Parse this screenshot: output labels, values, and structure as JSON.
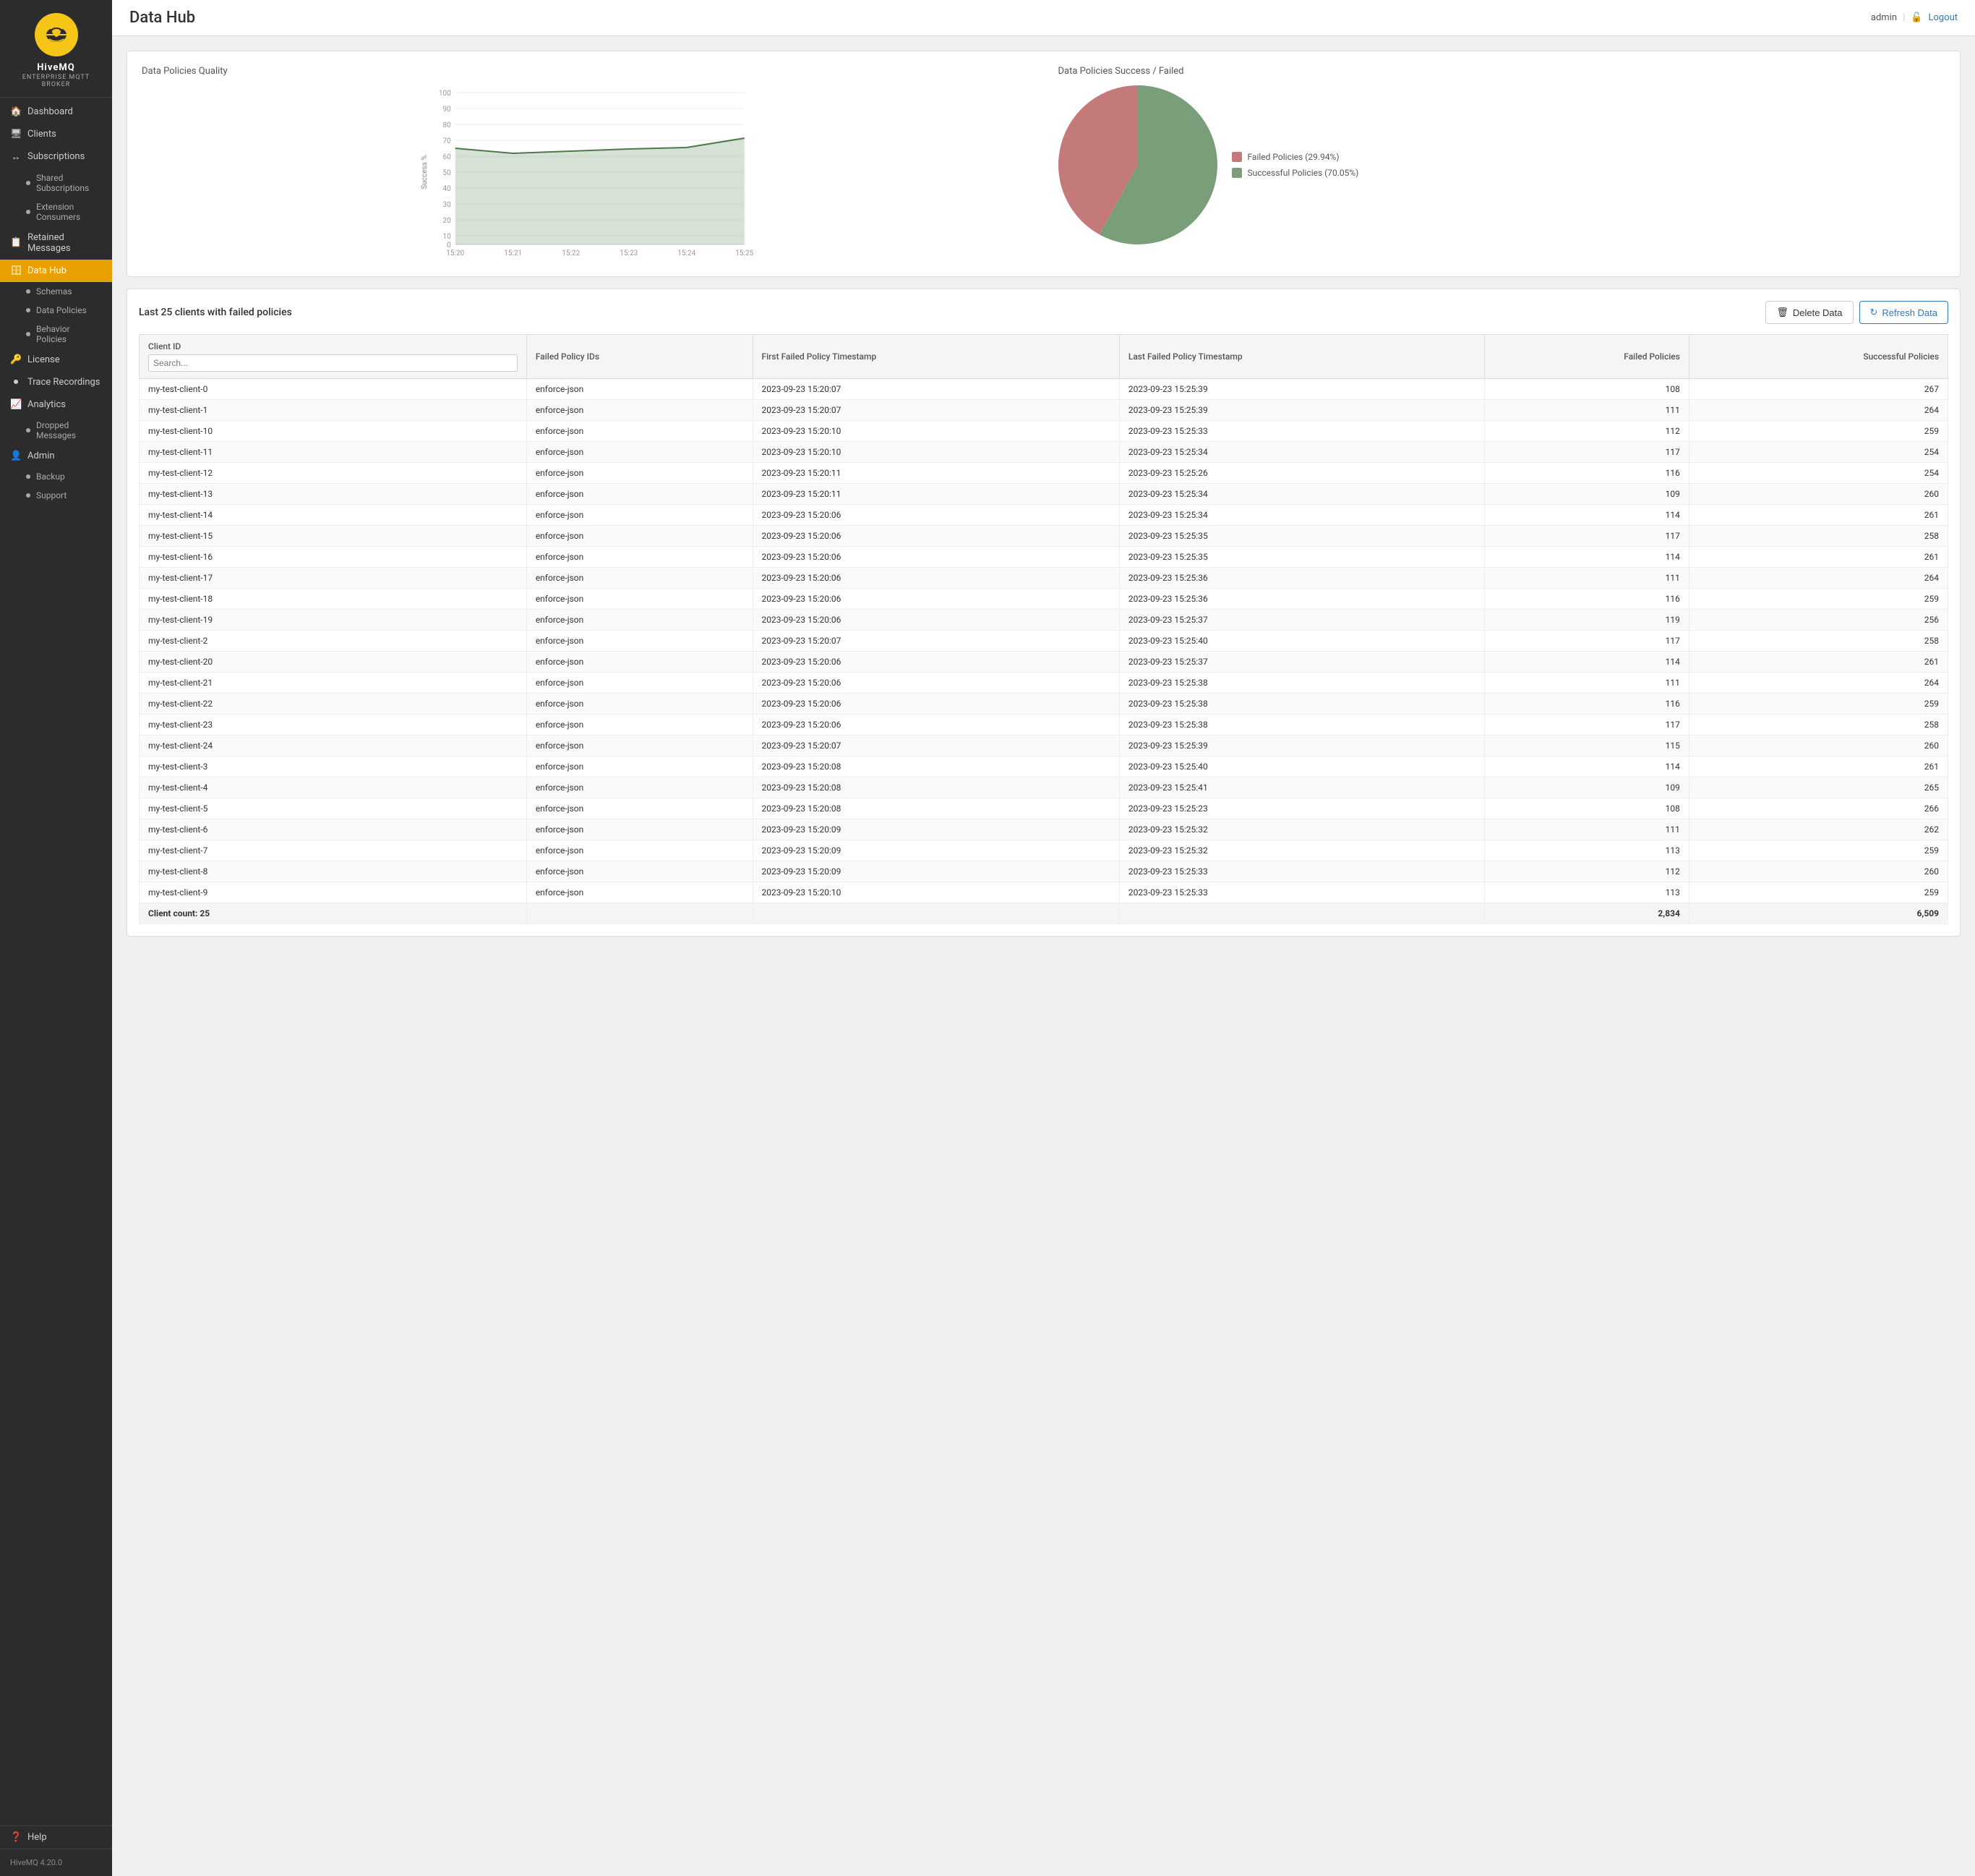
{
  "app": {
    "version": "HiveMQ 4.20.0",
    "title": "Data Hub"
  },
  "topbar": {
    "title": "Data Hub",
    "user": "admin",
    "logout_label": "Logout"
  },
  "sidebar": {
    "nav": [
      {
        "id": "dashboard",
        "label": "Dashboard",
        "icon": "🏠",
        "active": false
      },
      {
        "id": "clients",
        "label": "Clients",
        "icon": "🖥",
        "active": false
      },
      {
        "id": "subscriptions",
        "label": "Subscriptions",
        "icon": "↔",
        "active": false,
        "children": [
          {
            "id": "shared-subscriptions",
            "label": "Shared Subscriptions"
          },
          {
            "id": "extension-consumers",
            "label": "Extension Consumers"
          }
        ]
      },
      {
        "id": "retained-messages",
        "label": "Retained Messages",
        "icon": "📋",
        "active": false
      },
      {
        "id": "data-hub",
        "label": "Data Hub",
        "icon": "🗄",
        "active": true,
        "children": [
          {
            "id": "schemas",
            "label": "Schemas"
          },
          {
            "id": "data-policies",
            "label": "Data Policies"
          },
          {
            "id": "behavior-policies",
            "label": "Behavior Policies"
          }
        ]
      },
      {
        "id": "license",
        "label": "License",
        "icon": "🔑",
        "active": false
      },
      {
        "id": "trace-recordings",
        "label": "Trace Recordings",
        "icon": "⏺",
        "active": false
      },
      {
        "id": "analytics",
        "label": "Analytics",
        "icon": "📈",
        "active": false,
        "children": [
          {
            "id": "dropped-messages",
            "label": "Dropped Messages"
          }
        ]
      },
      {
        "id": "admin",
        "label": "Admin",
        "icon": "👤",
        "active": false,
        "children": [
          {
            "id": "backup",
            "label": "Backup"
          },
          {
            "id": "support",
            "label": "Support"
          }
        ]
      }
    ],
    "help": "Help"
  },
  "charts": {
    "line_chart": {
      "title": "Data Policies Quality",
      "y_label": "Success %",
      "y_ticks": [
        0,
        10,
        20,
        30,
        40,
        50,
        60,
        70,
        80,
        90,
        100
      ],
      "x_ticks": [
        "15:20",
        "15:21",
        "15:22",
        "15:23",
        "15:24",
        "15:25"
      ]
    },
    "pie_chart": {
      "title": "Data Policies Success / Failed",
      "failed_label": "Failed Policies (29.94%)",
      "success_label": "Successful Policies (70.05%)",
      "failed_pct": 29.94,
      "success_pct": 70.05,
      "failed_color": "#c47a7a",
      "success_color": "#7a9e7a"
    }
  },
  "table_section": {
    "title": "Last 25 clients with failed policies",
    "delete_label": "Delete Data",
    "refresh_label": "Refresh Data",
    "columns": [
      {
        "id": "client-id",
        "label": "Client ID",
        "sortable": true
      },
      {
        "id": "failed-policy-ids",
        "label": "Failed Policy IDs"
      },
      {
        "id": "first-failed",
        "label": "First Failed Policy Timestamp"
      },
      {
        "id": "last-failed",
        "label": "Last Failed Policy Timestamp"
      },
      {
        "id": "failed-policies",
        "label": "Failed Policies",
        "align": "right"
      },
      {
        "id": "successful-policies",
        "label": "Successful Policies",
        "align": "right"
      }
    ],
    "rows": [
      {
        "client_id": "my-test-client-0",
        "policy_ids": "enforce-json",
        "first_failed": "2023-09-23 15:20:07",
        "last_failed": "2023-09-23 15:25:39",
        "failed": 108,
        "successful": 267
      },
      {
        "client_id": "my-test-client-1",
        "policy_ids": "enforce-json",
        "first_failed": "2023-09-23 15:20:07",
        "last_failed": "2023-09-23 15:25:39",
        "failed": 111,
        "successful": 264
      },
      {
        "client_id": "my-test-client-10",
        "policy_ids": "enforce-json",
        "first_failed": "2023-09-23 15:20:10",
        "last_failed": "2023-09-23 15:25:33",
        "failed": 112,
        "successful": 259
      },
      {
        "client_id": "my-test-client-11",
        "policy_ids": "enforce-json",
        "first_failed": "2023-09-23 15:20:10",
        "last_failed": "2023-09-23 15:25:34",
        "failed": 117,
        "successful": 254
      },
      {
        "client_id": "my-test-client-12",
        "policy_ids": "enforce-json",
        "first_failed": "2023-09-23 15:20:11",
        "last_failed": "2023-09-23 15:25:26",
        "failed": 116,
        "successful": 254
      },
      {
        "client_id": "my-test-client-13",
        "policy_ids": "enforce-json",
        "first_failed": "2023-09-23 15:20:11",
        "last_failed": "2023-09-23 15:25:34",
        "failed": 109,
        "successful": 260
      },
      {
        "client_id": "my-test-client-14",
        "policy_ids": "enforce-json",
        "first_failed": "2023-09-23 15:20:06",
        "last_failed": "2023-09-23 15:25:34",
        "failed": 114,
        "successful": 261
      },
      {
        "client_id": "my-test-client-15",
        "policy_ids": "enforce-json",
        "first_failed": "2023-09-23 15:20:06",
        "last_failed": "2023-09-23 15:25:35",
        "failed": 117,
        "successful": 258
      },
      {
        "client_id": "my-test-client-16",
        "policy_ids": "enforce-json",
        "first_failed": "2023-09-23 15:20:06",
        "last_failed": "2023-09-23 15:25:35",
        "failed": 114,
        "successful": 261
      },
      {
        "client_id": "my-test-client-17",
        "policy_ids": "enforce-json",
        "first_failed": "2023-09-23 15:20:06",
        "last_failed": "2023-09-23 15:25:36",
        "failed": 111,
        "successful": 264
      },
      {
        "client_id": "my-test-client-18",
        "policy_ids": "enforce-json",
        "first_failed": "2023-09-23 15:20:06",
        "last_failed": "2023-09-23 15:25:36",
        "failed": 116,
        "successful": 259
      },
      {
        "client_id": "my-test-client-19",
        "policy_ids": "enforce-json",
        "first_failed": "2023-09-23 15:20:06",
        "last_failed": "2023-09-23 15:25:37",
        "failed": 119,
        "successful": 256
      },
      {
        "client_id": "my-test-client-2",
        "policy_ids": "enforce-json",
        "first_failed": "2023-09-23 15:20:07",
        "last_failed": "2023-09-23 15:25:40",
        "failed": 117,
        "successful": 258
      },
      {
        "client_id": "my-test-client-20",
        "policy_ids": "enforce-json",
        "first_failed": "2023-09-23 15:20:06",
        "last_failed": "2023-09-23 15:25:37",
        "failed": 114,
        "successful": 261
      },
      {
        "client_id": "my-test-client-21",
        "policy_ids": "enforce-json",
        "first_failed": "2023-09-23 15:20:06",
        "last_failed": "2023-09-23 15:25:38",
        "failed": 111,
        "successful": 264
      },
      {
        "client_id": "my-test-client-22",
        "policy_ids": "enforce-json",
        "first_failed": "2023-09-23 15:20:06",
        "last_failed": "2023-09-23 15:25:38",
        "failed": 116,
        "successful": 259
      },
      {
        "client_id": "my-test-client-23",
        "policy_ids": "enforce-json",
        "first_failed": "2023-09-23 15:20:06",
        "last_failed": "2023-09-23 15:25:38",
        "failed": 117,
        "successful": 258
      },
      {
        "client_id": "my-test-client-24",
        "policy_ids": "enforce-json",
        "first_failed": "2023-09-23 15:20:07",
        "last_failed": "2023-09-23 15:25:39",
        "failed": 115,
        "successful": 260
      },
      {
        "client_id": "my-test-client-3",
        "policy_ids": "enforce-json",
        "first_failed": "2023-09-23 15:20:08",
        "last_failed": "2023-09-23 15:25:40",
        "failed": 114,
        "successful": 261
      },
      {
        "client_id": "my-test-client-4",
        "policy_ids": "enforce-json",
        "first_failed": "2023-09-23 15:20:08",
        "last_failed": "2023-09-23 15:25:41",
        "failed": 109,
        "successful": 265
      },
      {
        "client_id": "my-test-client-5",
        "policy_ids": "enforce-json",
        "first_failed": "2023-09-23 15:20:08",
        "last_failed": "2023-09-23 15:25:23",
        "failed": 108,
        "successful": 266
      },
      {
        "client_id": "my-test-client-6",
        "policy_ids": "enforce-json",
        "first_failed": "2023-09-23 15:20:09",
        "last_failed": "2023-09-23 15:25:32",
        "failed": 111,
        "successful": 262
      },
      {
        "client_id": "my-test-client-7",
        "policy_ids": "enforce-json",
        "first_failed": "2023-09-23 15:20:09",
        "last_failed": "2023-09-23 15:25:32",
        "failed": 113,
        "successful": 259
      },
      {
        "client_id": "my-test-client-8",
        "policy_ids": "enforce-json",
        "first_failed": "2023-09-23 15:20:09",
        "last_failed": "2023-09-23 15:25:33",
        "failed": 112,
        "successful": 260
      },
      {
        "client_id": "my-test-client-9",
        "policy_ids": "enforce-json",
        "first_failed": "2023-09-23 15:20:10",
        "last_failed": "2023-09-23 15:25:33",
        "failed": 113,
        "successful": 259
      }
    ],
    "footer": {
      "label": "Client count: 25",
      "total_failed": "2,834",
      "total_successful": "6,509"
    }
  }
}
